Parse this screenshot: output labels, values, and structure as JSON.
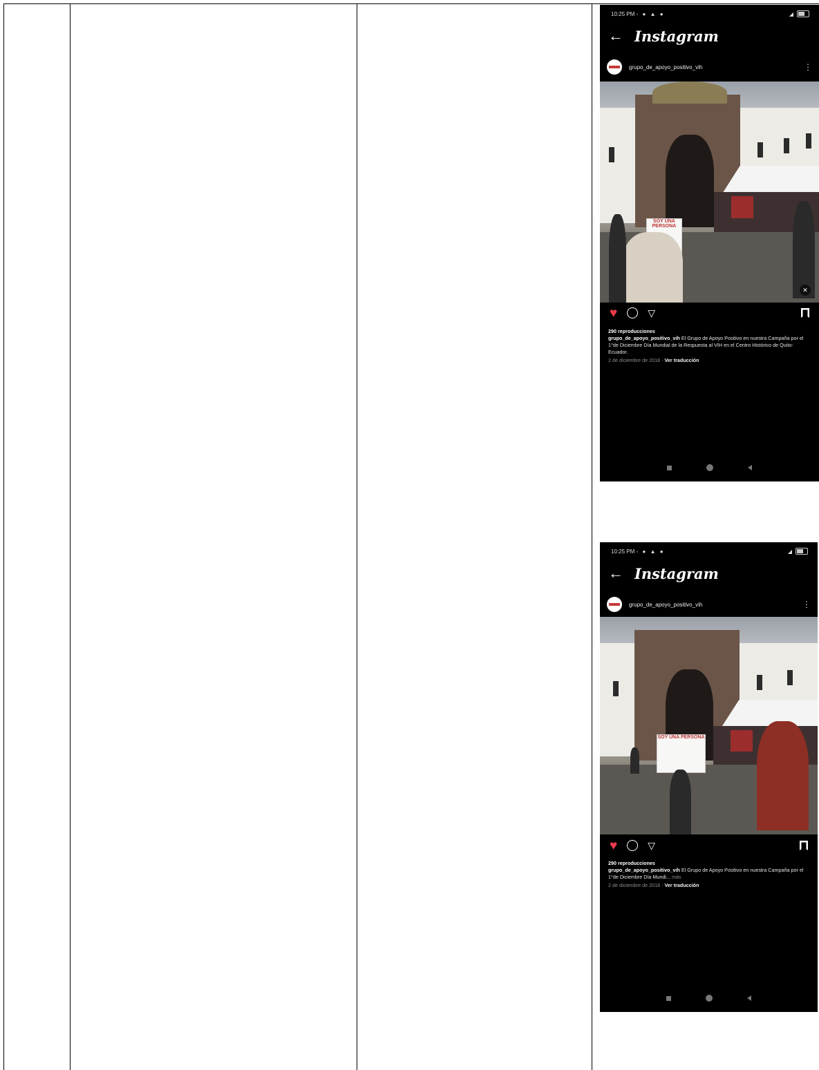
{
  "phone_posts": [
    {
      "status_time": "10:25 PM",
      "app_title": "Instagram",
      "username": "grupo_de_apoyo_positivo_vih",
      "views": "290 reproducciones",
      "caption_user": "grupo_de_apoyo_positivo_vih",
      "caption_text": "El Grupo de Apoyo Positivo en nuestra Campaña por el 1°de Diciembre Día Mundial de la Respuesta al VIH en el Centro Histórico de Quito-Ecuador.",
      "date": "2 de diciembre de 2018",
      "translate": "Ver traducción",
      "sign_text": "SOY UNA PERSONA"
    },
    {
      "status_time": "10:25 PM",
      "app_title": "Instagram",
      "username": "grupo_de_apoyo_positivo_vih",
      "views": "290 reproducciones",
      "caption_user": "grupo_de_apoyo_positivo_vih",
      "caption_text": "El Grupo de Apoyo Positivo en nuestra Campaña por el 1°de Diciembre Día Mundi...",
      "caption_more": "más",
      "date": "2 de diciembre de 2018",
      "translate": "Ver traducción",
      "sign_text": "SOY UNA PERSONA"
    }
  ],
  "icons": [
    "back-arrow-icon",
    "heart-icon",
    "comment-icon",
    "share-icon",
    "bookmark-icon",
    "more-options-icon",
    "mute-icon"
  ],
  "colors": {
    "like": "#ed3b4b",
    "background": "#000000"
  }
}
